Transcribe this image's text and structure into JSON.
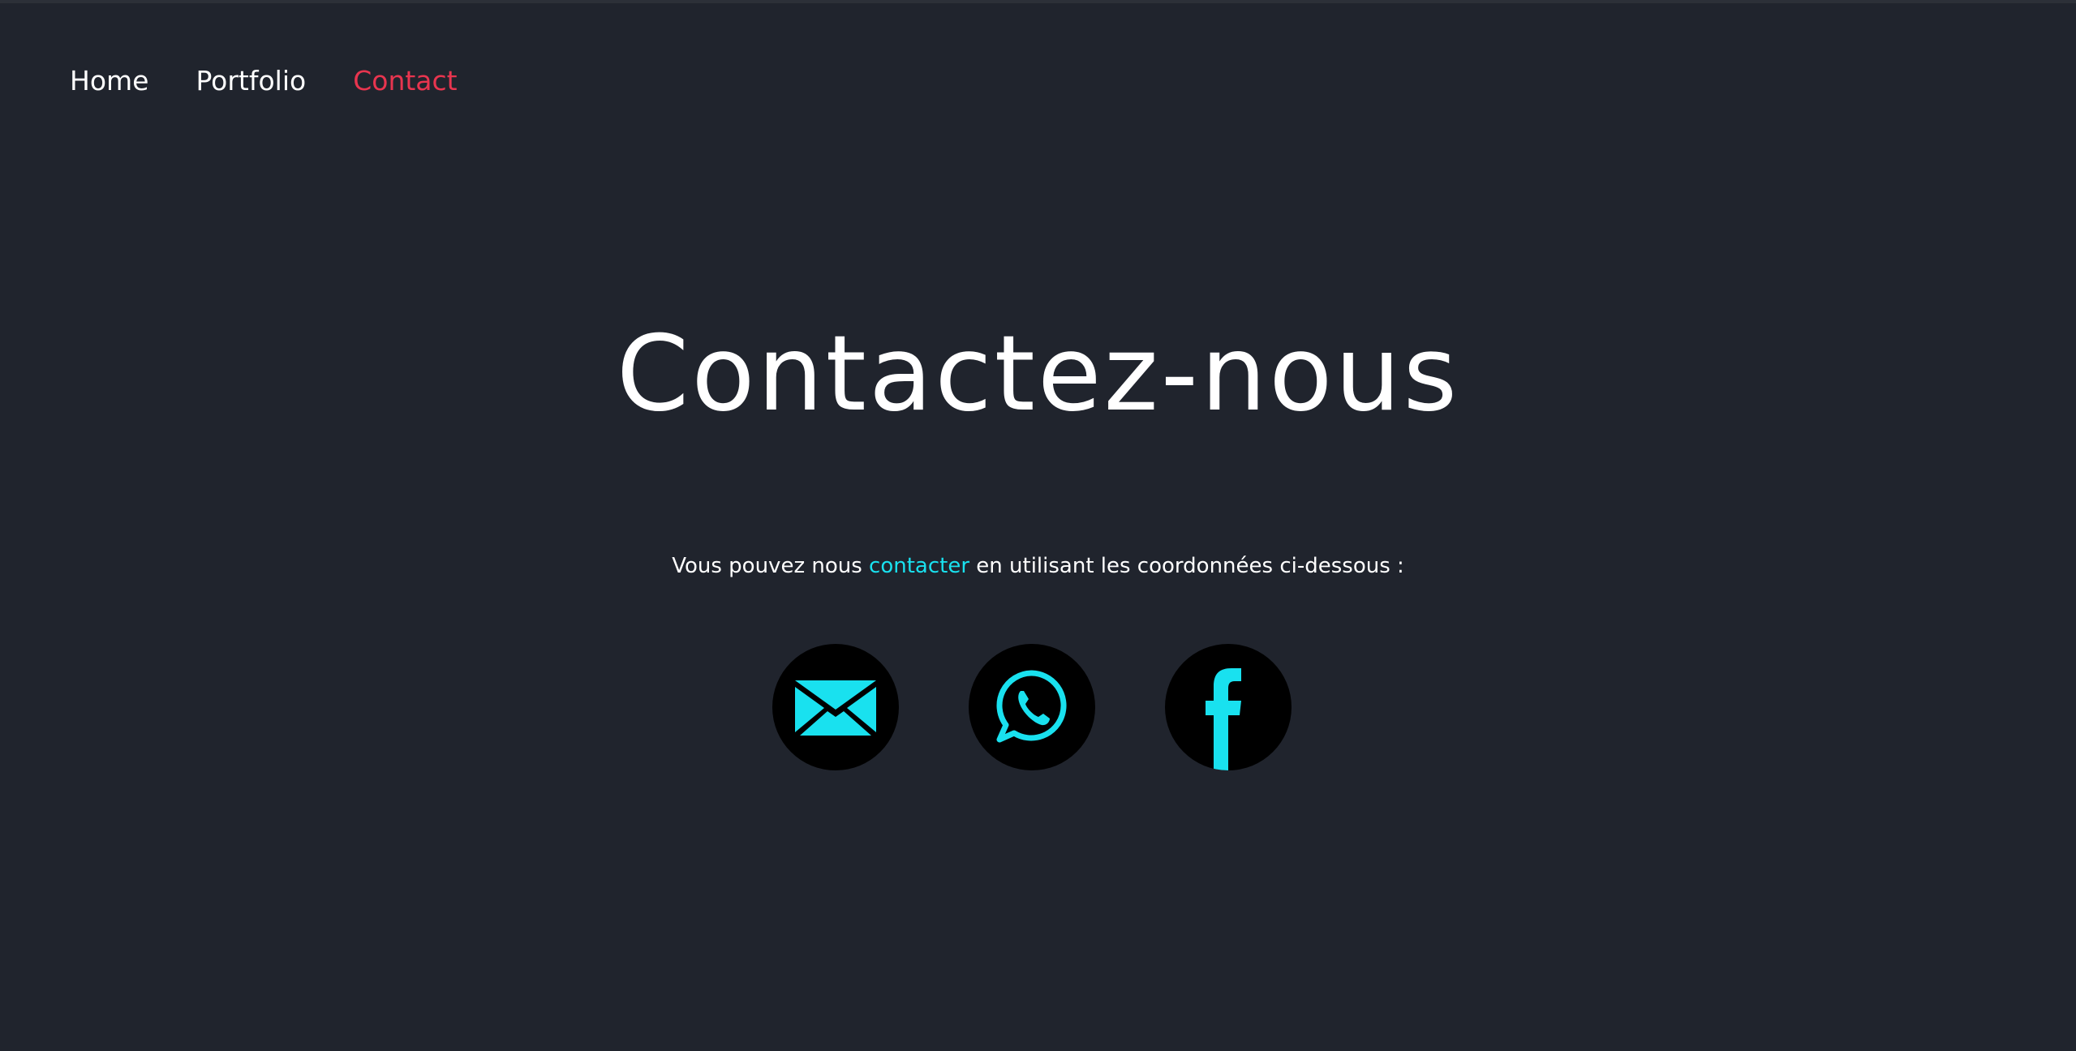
{
  "nav": {
    "items": [
      {
        "label": "Home",
        "active": false
      },
      {
        "label": "Portfolio",
        "active": false
      },
      {
        "label": "Contact",
        "active": true
      }
    ]
  },
  "main": {
    "title": "Contactez-nous",
    "subtitle_before": "Vous pouvez nous ",
    "subtitle_link": "contacter",
    "subtitle_after": " en utilisant les coordonnées ci-dessous :"
  },
  "contact_icons": [
    {
      "name": "email-icon"
    },
    {
      "name": "whatsapp-icon"
    },
    {
      "name": "facebook-icon"
    }
  ],
  "colors": {
    "background": "#20242d",
    "accent": "#19e1ef",
    "active_nav": "#e8354f",
    "icon_circle": "#000000"
  }
}
